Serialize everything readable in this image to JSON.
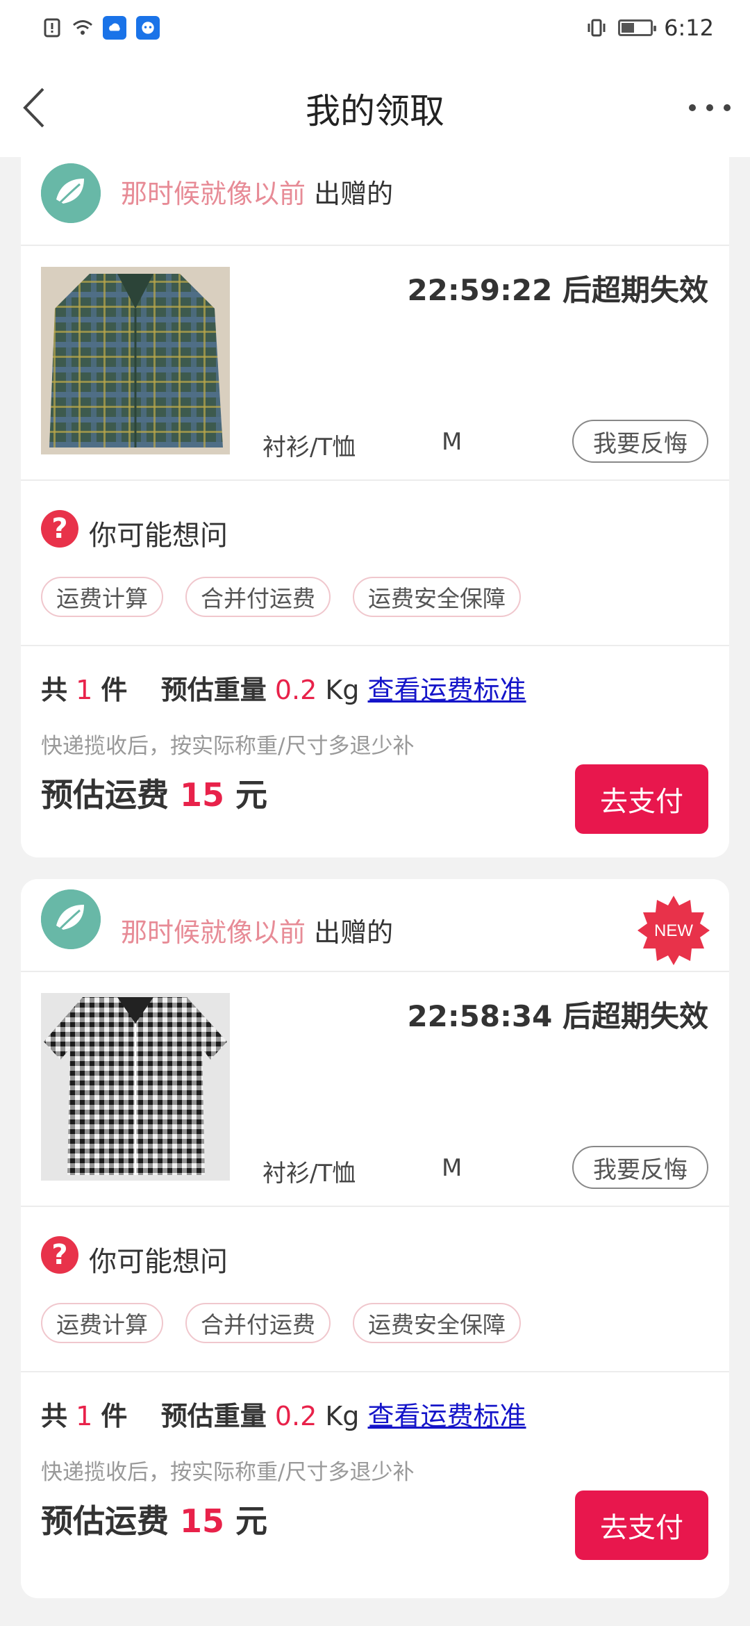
{
  "status_bar": {
    "time": "6:12"
  },
  "header": {
    "title": "我的领取"
  },
  "cards": [
    {
      "giver_name": "那时候就像以前",
      "giver_suffix": "出赠的",
      "countdown": "22:59:22 后超期失效",
      "category": "衬衫/T恤",
      "size": "M",
      "regret_label": "我要反悔",
      "faq_title": "你可能想问",
      "chips": [
        "运费计算",
        "合并付运费",
        "运费安全保障"
      ],
      "qty_prefix": "共",
      "qty": "1",
      "qty_unit": "件",
      "weight_label": "预估重量",
      "weight_value": "0.2",
      "weight_unit": "Kg",
      "freight_link": "查看运费标准",
      "note": "快递揽收后，按实际称重/尺寸多退少补",
      "fee_label": "预估运费",
      "fee_value": "15",
      "fee_unit": "元",
      "pay_label": "去支付",
      "show_new": false
    },
    {
      "giver_name": "那时候就像以前",
      "giver_suffix": "出赠的",
      "new_badge": "NEW",
      "countdown": "22:58:34 后超期失效",
      "category": "衬衫/T恤",
      "size": "M",
      "regret_label": "我要反悔",
      "faq_title": "你可能想问",
      "chips": [
        "运费计算",
        "合并付运费",
        "运费安全保障"
      ],
      "qty_prefix": "共",
      "qty": "1",
      "qty_unit": "件",
      "weight_label": "预估重量",
      "weight_value": "0.2",
      "weight_unit": "Kg",
      "freight_link": "查看运费标准",
      "note": "快递揽收后，按实际称重/尺寸多退少补",
      "fee_label": "预估运费",
      "fee_value": "15",
      "fee_unit": "元",
      "pay_label": "去支付",
      "show_new": true
    }
  ],
  "colors": {
    "accent": "#e8174d",
    "giver_name": "#e78b96",
    "avatar": "#68b8a7",
    "link": "#1515c9"
  },
  "icons": [
    "sim-alert-icon",
    "wifi-icon",
    "weather-app-icon",
    "bot-app-icon",
    "vibrate-icon",
    "battery-icon",
    "back-arrow-icon",
    "more-icon",
    "leaf-avatar-icon",
    "question-icon",
    "new-badge-icon"
  ]
}
